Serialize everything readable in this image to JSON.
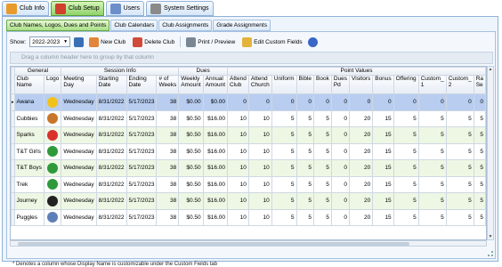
{
  "top_tabs": [
    {
      "label": "Club Info",
      "icon": "club-info-icon"
    },
    {
      "label": "Club Setup",
      "icon": "club-setup-icon",
      "active": true
    },
    {
      "label": "Users",
      "icon": "users-icon"
    },
    {
      "label": "System Settings",
      "icon": "settings-icon"
    }
  ],
  "sub_tabs": [
    {
      "label": "Club Names, Logos, Dues and Points",
      "active": true
    },
    {
      "label": "Club Calendars"
    },
    {
      "label": "Club Assignments"
    },
    {
      "label": "Grade Assignments"
    }
  ],
  "toolbar": {
    "show_label": "Show:",
    "year_value": "2022-2023",
    "new_club": "New Club",
    "delete_club": "Delete Club",
    "print_preview": "Print / Preview",
    "edit_custom_fields": "Edit Custom Fields"
  },
  "group_hint": "Drag a column header here to group by that column",
  "grid": {
    "groups": {
      "general": "General",
      "session": "Session Info",
      "dues": "Dues",
      "points": "Point Values"
    },
    "columns": [
      "Club Name",
      "Logo",
      "Meeting Day",
      "Starting Date",
      "Ending Date",
      "# of Weeks",
      "Weekly Amount",
      "Annual Amount",
      "Attend Club",
      "Attend Church",
      "Uniform",
      "Bible",
      "Book",
      "Dues Pd",
      "Visitors",
      "Bonus",
      "Offering",
      "Custom_ 1",
      "Custom_ 2",
      "Ra Se"
    ],
    "rows": [
      [
        "Awana",
        "A",
        "Wednesday",
        "8/31/2022",
        "5/17/2023",
        "38",
        "$0.00",
        "$0.00",
        "0",
        "0",
        "0",
        "0",
        "0",
        "0",
        "0",
        "0",
        "0",
        "0",
        "0",
        "0"
      ],
      [
        "Cubbies",
        "C",
        "Wednesday",
        "8/31/2022",
        "5/17/2023",
        "38",
        "$0.50",
        "$16.00",
        "10",
        "10",
        "5",
        "5",
        "5",
        "0",
        "20",
        "15",
        "5",
        "5",
        "5",
        "5"
      ],
      [
        "Sparks",
        "S",
        "Wednesday",
        "8/31/2022",
        "5/17/2023",
        "38",
        "$0.50",
        "$16.00",
        "10",
        "10",
        "5",
        "5",
        "5",
        "0",
        "20",
        "15",
        "5",
        "5",
        "5",
        "5"
      ],
      [
        "T&T Girls",
        "G",
        "Wednesday",
        "8/31/2022",
        "5/17/2023",
        "38",
        "$0.50",
        "$16.00",
        "10",
        "10",
        "5",
        "5",
        "5",
        "0",
        "20",
        "15",
        "5",
        "5",
        "5",
        "5"
      ],
      [
        "T&T Boys",
        "G",
        "Wednesday",
        "8/31/2022",
        "5/17/2023",
        "38",
        "$0.50",
        "$16.00",
        "10",
        "10",
        "5",
        "5",
        "5",
        "0",
        "20",
        "15",
        "5",
        "5",
        "5",
        "5"
      ],
      [
        "Trek",
        "G",
        "Wednesday",
        "8/31/2022",
        "5/17/2023",
        "38",
        "$0.50",
        "$16.00",
        "10",
        "10",
        "5",
        "5",
        "5",
        "0",
        "20",
        "15",
        "5",
        "5",
        "5",
        "5"
      ],
      [
        "Journey",
        "J",
        "Wednesday",
        "8/31/2022",
        "5/17/2023",
        "38",
        "$0.50",
        "$16.00",
        "10",
        "10",
        "5",
        "5",
        "5",
        "0",
        "20",
        "15",
        "5",
        "5",
        "5",
        "5"
      ],
      [
        "Puggles",
        "P",
        "Wednesday",
        "8/31/2022",
        "5/17/2023",
        "38",
        "$0.50",
        "$16.00",
        "10",
        "10",
        "5",
        "5",
        "5",
        "0",
        "20",
        "15",
        "5",
        "5",
        "5",
        "5"
      ]
    ],
    "logo_colors": [
      "#f2c21b",
      "#c8762a",
      "#d8322b",
      "#2f9a3a",
      "#2f9a3a",
      "#2f9a3a",
      "#222222",
      "#5d7fb8"
    ]
  },
  "footnote": "* Denotes a column whose Display Name is customizable under the Custom Fields tab"
}
